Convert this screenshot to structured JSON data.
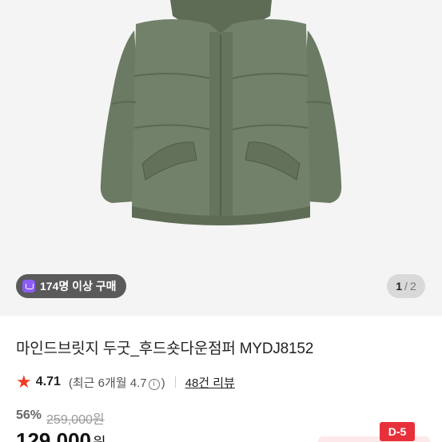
{
  "gallery": {
    "buyers_badge": "174명 이상 구매",
    "page_current": "1",
    "page_separator": "/",
    "page_total": "2",
    "image_subject": "olive green hooded down jacket"
  },
  "product": {
    "title": "마인드브릿지 두굿_후드숏다운점퍼 MYDJ8152",
    "rating": "4.71",
    "recent_rating_prefix": "(최근 6개월 4.7",
    "recent_rating_suffix": ")",
    "review_count": "48건 리뷰",
    "discount_percent": "56%",
    "original_price": "259,000원",
    "price": "129,000",
    "price_unit": "원",
    "deadline_badge": "D-5"
  },
  "colors": {
    "accent_red": "#e8303a",
    "star": "#ef3c28",
    "badge_purple": "#8b5cf6",
    "jacket_olive": "#6b7a62"
  },
  "icons": {
    "star": "star-icon",
    "info": "info-icon",
    "bag": "shopping-bag-icon"
  }
}
